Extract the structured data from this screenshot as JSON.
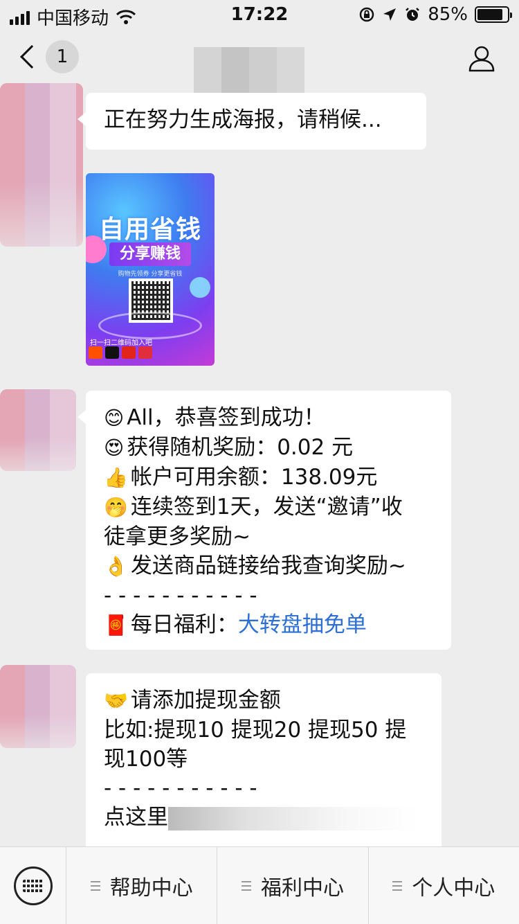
{
  "status_bar": {
    "carrier": "中国移动",
    "time": "17:22",
    "battery": "85%",
    "battery_level": 0.85
  },
  "nav": {
    "unread_count": "1"
  },
  "messages": {
    "m1": {
      "text": "正在努力生成海报，请稍候..."
    },
    "poster": {
      "title": "自用省钱",
      "subtitle": "分享赚钱",
      "tagline": "购物先领券  分享更省钱",
      "footer": "扫一扫二维码加入吧"
    },
    "m3": {
      "line1_emoji": "😊",
      "line1": "All，恭喜签到成功！",
      "line2_emoji": "😍",
      "line2": "获得随机奖励：0.02 元",
      "line3_emoji": "👍",
      "line3": "帐户可用余额：138.09元",
      "line4_emoji": "🤭",
      "line4a": "连续签到1天，发送“邀请”收",
      "line4b": "徒拿更多奖励~",
      "line5_emoji": "👌",
      "line5": "发送商品链接给我查询奖励~",
      "divider": "- - - - - - - - - - -",
      "line6_emoji": "🧧",
      "line6_label": "每日福利：",
      "line6_link": "大转盘抽免单"
    },
    "m4": {
      "line1_emoji": "🤝",
      "line1": "请添加提现金额",
      "line2": "比如:提现10 提现20 提现50 提",
      "line3": "现100等",
      "divider": "- - - - - - - - - - -",
      "line4": "点这里"
    }
  },
  "bottom_menu": {
    "items": [
      {
        "label": "帮助中心"
      },
      {
        "label": "福利中心"
      },
      {
        "label": "个人中心"
      }
    ]
  }
}
